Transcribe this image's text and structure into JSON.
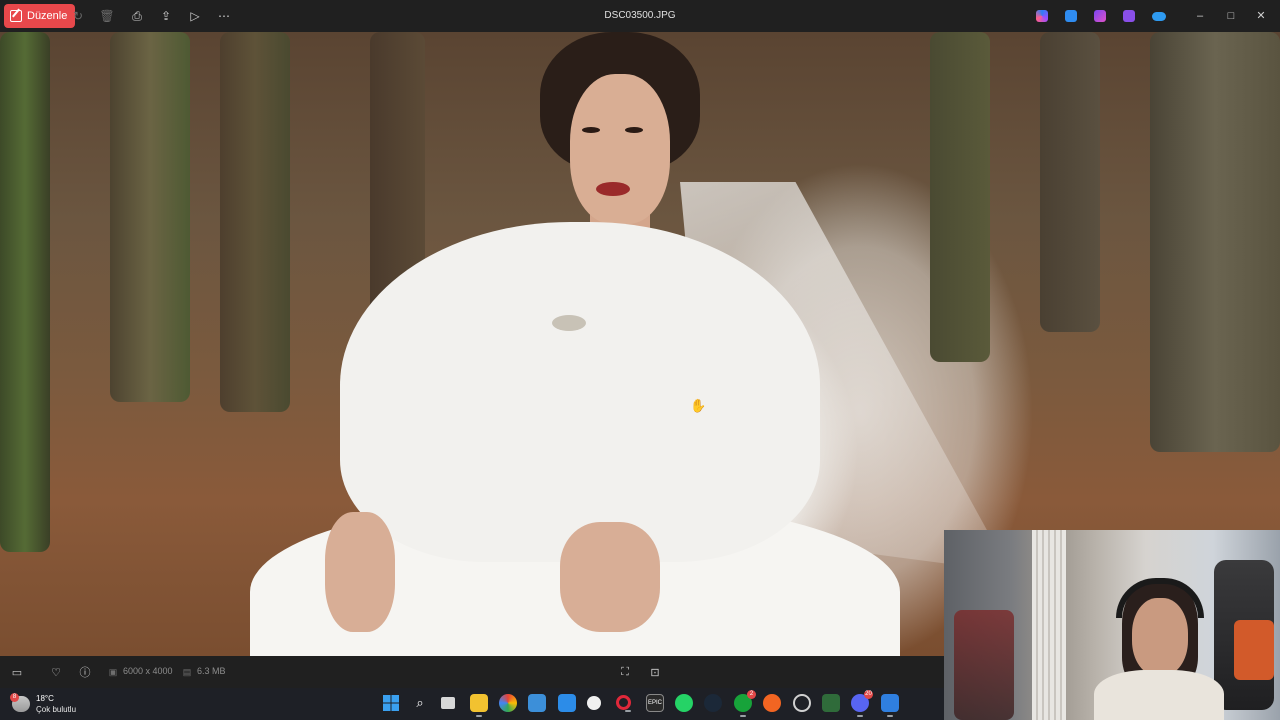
{
  "toolbar": {
    "edit_label": "Düzenle",
    "title": "DSC03500.JPG",
    "icons": [
      "edit-icon",
      "rotate-icon",
      "delete-icon",
      "print-icon",
      "share-icon",
      "slideshow-icon",
      "more-icon"
    ],
    "cloud_icons": [
      "copilot-icon",
      "designer-icon",
      "clipchamp-icon",
      "stream-icon",
      "onedrive-icon"
    ],
    "window_controls": {
      "minimize": "–",
      "maximize": "□",
      "close": "✕"
    }
  },
  "statusbar": {
    "dimensions": "6000 x 4000",
    "filesize": "6.3 MB"
  },
  "taskbar": {
    "weather": {
      "temp": "18°C",
      "condition": "Çok bulutlu",
      "badge": "8"
    },
    "badges": {
      "xbox": "2",
      "discord": "20"
    }
  }
}
